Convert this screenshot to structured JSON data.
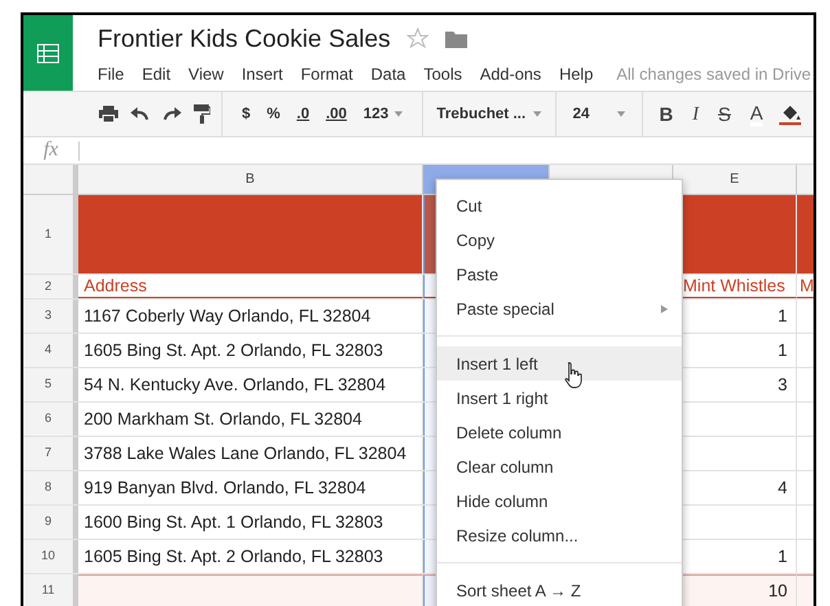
{
  "app": {
    "title": "Frontier Kids Cookie Sales",
    "starred": false,
    "save_status": "All changes saved in Drive"
  },
  "menu_bar": [
    "File",
    "Edit",
    "View",
    "Insert",
    "Format",
    "Data",
    "Tools",
    "Add-ons",
    "Help"
  ],
  "toolbar": {
    "number_formats": [
      "$",
      "%",
      ".0",
      ".00",
      "123"
    ],
    "font": "Trebuchet ...",
    "font_size": "24",
    "text_styles": [
      "B",
      "I",
      "S",
      "A"
    ]
  },
  "formula_bar": {
    "label": "fx"
  },
  "sheet": {
    "columns": [
      {
        "letter": "B",
        "selected": false
      },
      {
        "selected": true
      },
      {
        "selected": false
      },
      {
        "letter": "E",
        "selected": false
      }
    ],
    "rows": [
      {
        "number": "1",
        "kind": "banner",
        "cells": [
          "",
          "",
          "",
          "",
          ""
        ]
      },
      {
        "number": "2",
        "kind": "header",
        "cells": [
          "Address",
          "",
          "",
          "Mint Whistles",
          "M"
        ]
      },
      {
        "number": "3",
        "kind": "data",
        "cells": [
          "1167 Coberly Way Orlando, FL 32804",
          "",
          "",
          "1",
          ""
        ]
      },
      {
        "number": "4",
        "kind": "data",
        "cells": [
          "1605 Bing St. Apt. 2 Orlando, FL 32803",
          "",
          "",
          "1",
          ""
        ]
      },
      {
        "number": "5",
        "kind": "data",
        "cells": [
          "54 N. Kentucky Ave. Orlando, FL 32804",
          "",
          "",
          "3",
          ""
        ]
      },
      {
        "number": "6",
        "kind": "data",
        "cells": [
          "200 Markham St. Orlando, FL 32804",
          "",
          "",
          "",
          ""
        ]
      },
      {
        "number": "7",
        "kind": "data",
        "cells": [
          "3788 Lake Wales Lane Orlando, FL 32804",
          "",
          "",
          "",
          ""
        ]
      },
      {
        "number": "8",
        "kind": "data",
        "cells": [
          "919 Banyan Blvd. Orlando, FL 32804",
          "",
          "",
          "4",
          ""
        ]
      },
      {
        "number": "9",
        "kind": "data",
        "cells": [
          "1600 Bing St. Apt. 1 Orlando, FL 32803",
          "",
          "",
          "",
          ""
        ]
      },
      {
        "number": "10",
        "kind": "data",
        "cells": [
          "1605 Bing St. Apt. 2 Orlando, FL 32803",
          "",
          "",
          "1",
          ""
        ]
      },
      {
        "number": "11",
        "kind": "total",
        "cells": [
          "",
          "",
          "",
          "10",
          ""
        ]
      }
    ]
  },
  "context_menu": {
    "groups": [
      [
        {
          "label": "Cut",
          "selected": false,
          "submenu": false
        },
        {
          "label": "Copy",
          "selected": false,
          "submenu": false
        },
        {
          "label": "Paste",
          "selected": false,
          "submenu": false
        },
        {
          "label": "Paste special",
          "selected": false,
          "submenu": true
        }
      ],
      [
        {
          "label": "Insert 1 left",
          "selected": true,
          "submenu": false
        },
        {
          "label": "Insert 1 right",
          "selected": false,
          "submenu": false
        },
        {
          "label": "Delete column",
          "selected": false,
          "submenu": false
        },
        {
          "label": "Clear column",
          "selected": false,
          "submenu": false
        },
        {
          "label": "Hide column",
          "selected": false,
          "submenu": false
        },
        {
          "label": "Resize column...",
          "selected": false,
          "submenu": false
        }
      ],
      [
        {
          "label": "Sort sheet A → Z",
          "selected": false,
          "submenu": false
        }
      ]
    ]
  }
}
